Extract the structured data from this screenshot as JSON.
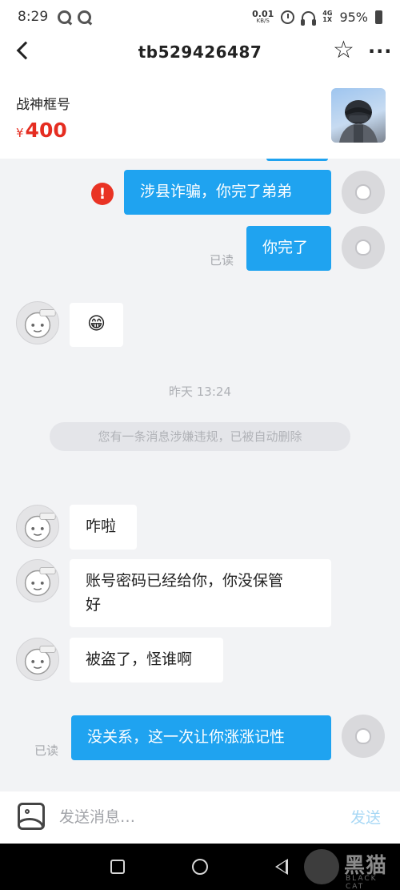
{
  "status_bar": {
    "time": "8:29",
    "net_speed_value": "0.01",
    "net_speed_unit": "KB/S",
    "net_type_top": "4G",
    "net_type_bottom": "1X",
    "battery": "95%"
  },
  "header": {
    "title": "tb529426487"
  },
  "product": {
    "name": "战神框号",
    "currency": "¥",
    "price": "400"
  },
  "messages": {
    "m1": "涉县诈骗，你完了弟弟",
    "m1_error": "!",
    "m2": "你完了",
    "m2_read": "已读",
    "m3": "😁",
    "time_separator": "昨天 13:24",
    "system_notice": "您有一条消息涉嫌违规，已被自动删除",
    "m4": "咋啦",
    "m5_line1": "账号密码已经给你，你没保管",
    "m5_line2": "好",
    "m6": "被盗了，怪谁啊",
    "m7": "没关系，这一次让你涨涨记性",
    "m7_read": "已读"
  },
  "input_bar": {
    "placeholder": "发送消息…",
    "send_label": "发送"
  },
  "watermark": {
    "title": "黑猫",
    "subtitle": "BLACK CAT"
  },
  "colors": {
    "outgoing_bubble": "#1fa3f0",
    "price": "#e52d21",
    "error": "#e93324",
    "send_disabled": "#a8d8f5"
  }
}
